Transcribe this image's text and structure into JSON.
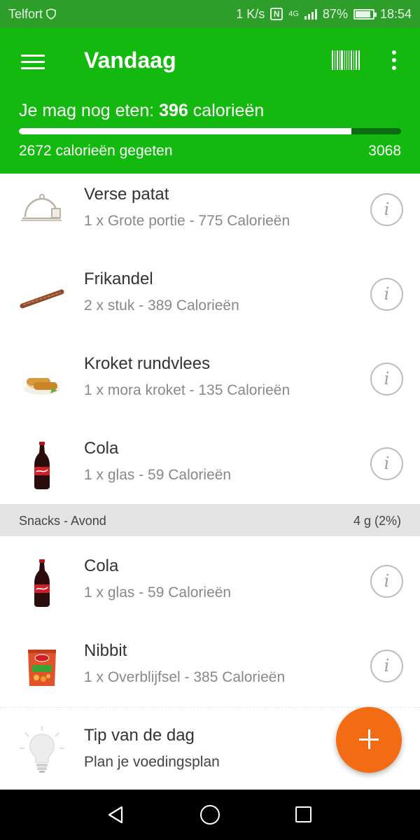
{
  "status": {
    "carrier": "Telfort",
    "speed": "1 K/s",
    "network": "4G",
    "battery": "87%",
    "time": "18:54"
  },
  "appbar": {
    "title": "Vandaag",
    "remaining_prefix": "Je mag nog eten: ",
    "remaining_value": "396",
    "remaining_suffix": " calorieën",
    "progress_fraction": 0.87,
    "eaten": "2672 calorieën gegeten",
    "goal": "3068",
    "icons": [
      "menu-icon",
      "barcode-icon",
      "more-vert-icon"
    ]
  },
  "list": [
    {
      "name": "Verse patat",
      "desc": "1 x Grote portie - 775 Calorieën",
      "icon": "food-tray-icon"
    },
    {
      "name": "Frikandel",
      "desc": "2 x stuk - 389 Calorieën",
      "icon": "frikandel-icon"
    },
    {
      "name": "Kroket rundvlees",
      "desc": "1 x mora kroket - 135 Calorieën",
      "icon": "kroket-icon"
    },
    {
      "name": "Cola",
      "desc": "1 x glas - 59 Calorieën",
      "icon": "cola-bottle-icon"
    }
  ],
  "section": {
    "label": "Snacks - Avond",
    "value": "4 g (2%)"
  },
  "snacks": [
    {
      "name": "Cola",
      "desc": "1 x glas - 59 Calorieën",
      "icon": "cola-bottle-icon"
    },
    {
      "name": "Nibbit",
      "desc": "1 x Overblijfsel - 385 Calorieën",
      "icon": "nibbit-bag-icon"
    }
  ],
  "tip": {
    "title": "Tip van de dag",
    "text": "Plan je voedingsplan",
    "icon": "lightbulb-icon"
  },
  "colors": {
    "appbar": "#13b90f",
    "statusbar": "#2e9e2a",
    "fab": "#f36b12",
    "section": "#e3e3e3"
  }
}
